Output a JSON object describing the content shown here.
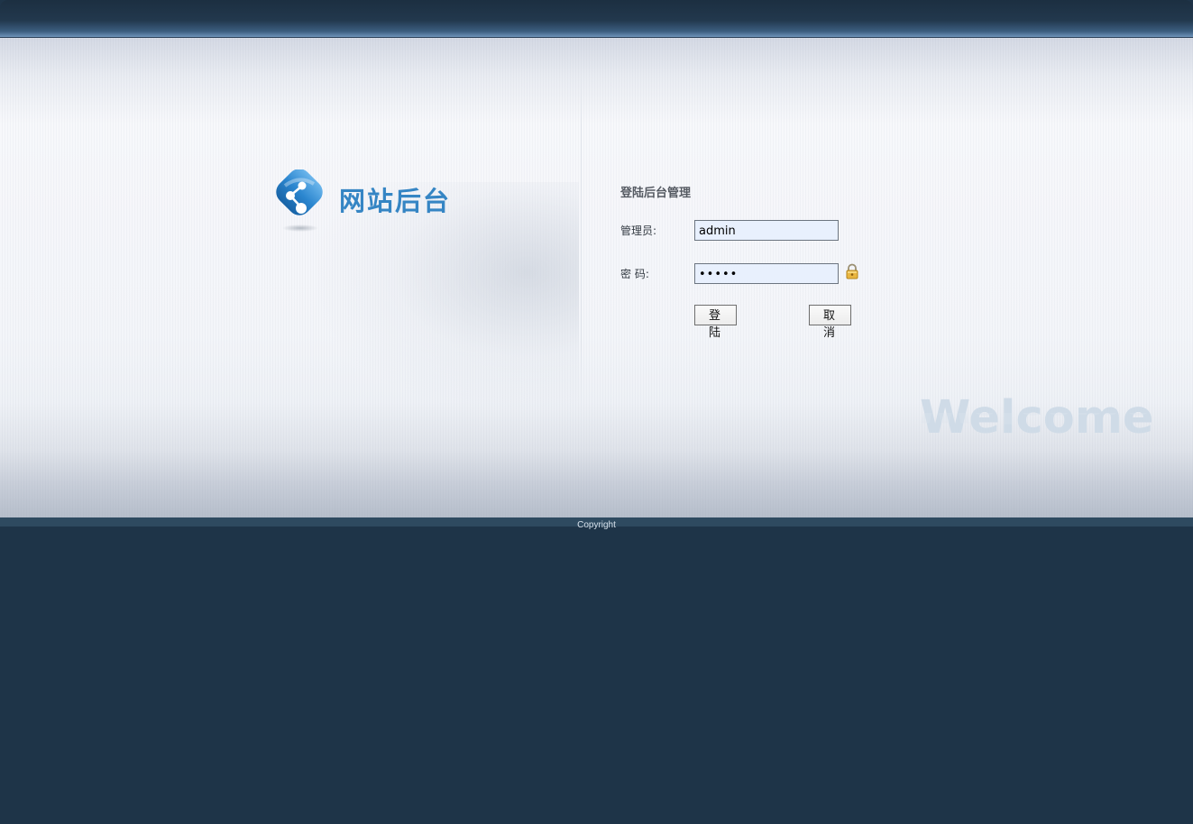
{
  "header": {
    "logo_text": "网站后台",
    "logo_icon": "share-icon"
  },
  "login_form": {
    "title": "登陆后台管理",
    "username_label": "管理员:",
    "username_value": "admin",
    "password_label": "密 码:",
    "password_value": "admin",
    "lock_icon": "lock-icon",
    "login_button": "登 陆",
    "cancel_button": "取 消"
  },
  "decor": {
    "welcome_text": "Welcome"
  },
  "footer": {
    "copyright": "Copyright"
  },
  "colors": {
    "background": "#1e3448",
    "accent": "#3585c4",
    "input_background": "#e8f0fd"
  }
}
